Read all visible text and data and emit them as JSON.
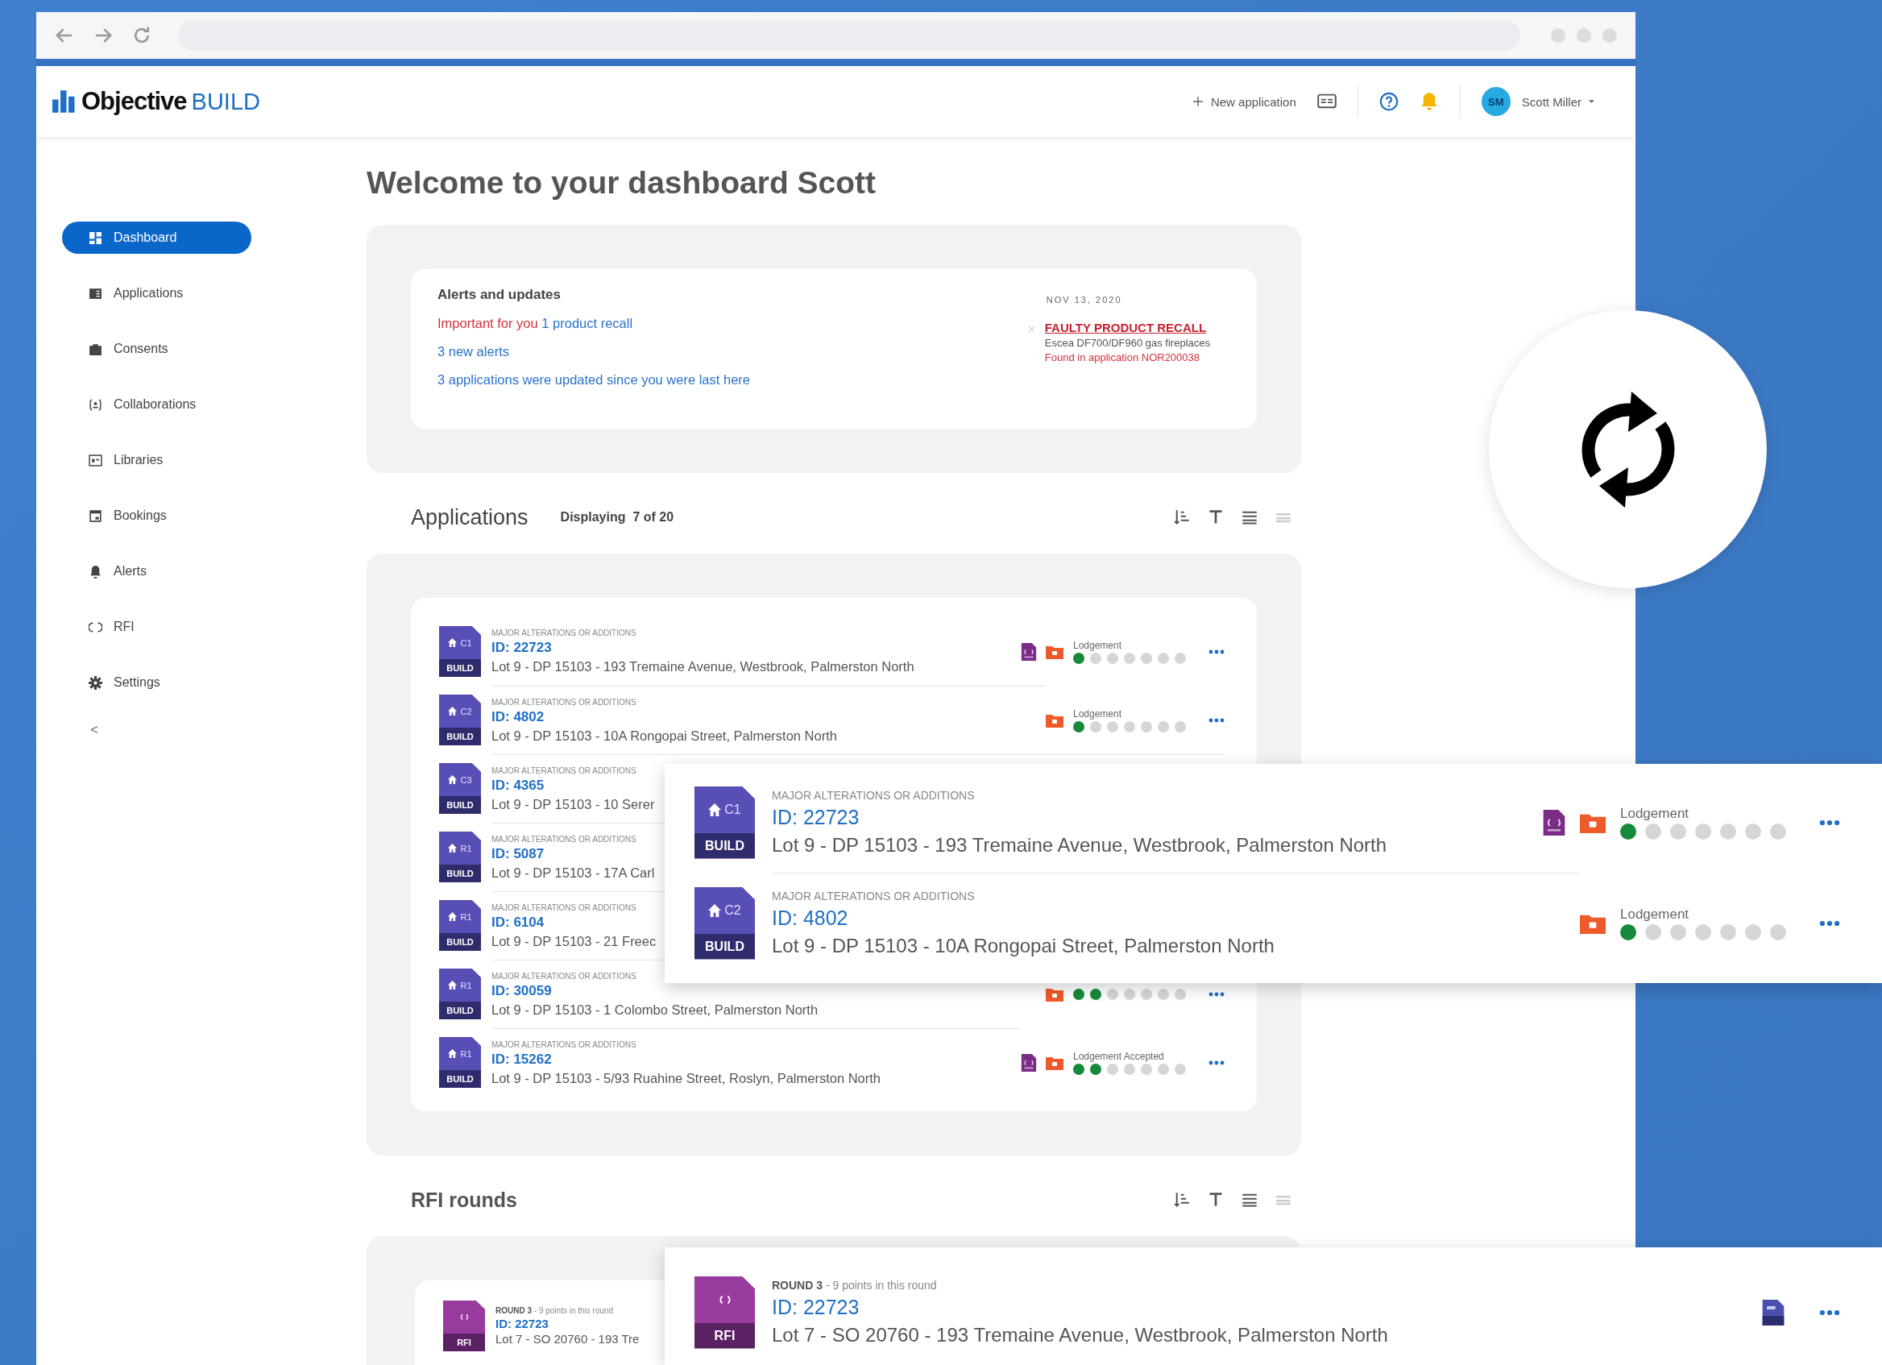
{
  "header": {
    "logo_name": "Objective",
    "logo_product": "BUILD",
    "new_application": "New application",
    "user": {
      "initials": "SM",
      "name": "Scott Miller"
    }
  },
  "sidebar": {
    "items": [
      {
        "label": "Dashboard",
        "kind": "dashboard",
        "selected": true
      },
      {
        "label": "Applications",
        "kind": "applications",
        "selected": false
      },
      {
        "label": "Consents",
        "kind": "consents",
        "selected": false
      },
      {
        "label": "Collaborations",
        "kind": "collaborations",
        "selected": false
      },
      {
        "label": "Libraries",
        "kind": "libraries",
        "selected": false
      },
      {
        "label": "Bookings",
        "kind": "bookings",
        "selected": false
      },
      {
        "label": "Alerts",
        "kind": "alerts",
        "selected": false
      },
      {
        "label": "RFI",
        "kind": "rfi",
        "selected": false
      },
      {
        "label": "Settings",
        "kind": "settings",
        "selected": false
      }
    ],
    "collapse": "<"
  },
  "page_title": "Welcome to your dashboard Scott",
  "alerts": {
    "title": "Alerts and updates",
    "lines": [
      {
        "kind": "important",
        "prefix": "Important for you",
        "text": "1 product recall"
      },
      {
        "kind": "link",
        "text": "3 new alerts"
      },
      {
        "kind": "link",
        "text": "3 applications were updated since you were last here"
      }
    ],
    "recall": {
      "date": "NOV 13, 2020",
      "title": "FAULTY PRODUCT RECALL",
      "product": "Escea DF700/DF960 gas fireplaces",
      "found": "Found in application NOR200038"
    }
  },
  "applications": {
    "title": "Applications",
    "displaying": "Displaying  7 of 20",
    "rows": [
      {
        "category": "MAJOR ALTERATIONS OR ADDITIONS",
        "badge": {
          "code": "C1",
          "label": "BUILD"
        },
        "id": "ID: 22723",
        "address": "Lot 9 - DP 15103 - 193 Tremaine Avenue, Westbrook, Palmerston North",
        "icons": [
          {
            "kind": "rfi"
          },
          {
            "kind": "folder"
          }
        ],
        "status": "Lodgement",
        "steps": [
          {
            "done": true
          },
          {
            "done": false
          },
          {
            "done": false
          },
          {
            "done": false
          },
          {
            "done": false
          },
          {
            "done": false
          },
          {
            "done": false
          }
        ]
      },
      {
        "category": "MAJOR ALTERATIONS OR ADDITIONS",
        "badge": {
          "code": "C2",
          "label": "BUILD"
        },
        "id": "ID: 4802",
        "address": "Lot 9 - DP 15103 - 10A Rongopai Street, Palmerston North",
        "icons": [
          {
            "kind": "folder"
          }
        ],
        "status": "Lodgement",
        "steps": [
          {
            "done": true
          },
          {
            "done": false
          },
          {
            "done": false
          },
          {
            "done": false
          },
          {
            "done": false
          },
          {
            "done": false
          },
          {
            "done": false
          }
        ]
      },
      {
        "category": "MAJOR ALTERATIONS OR ADDITIONS",
        "badge": {
          "code": "C3",
          "label": "BUILD"
        },
        "id": "ID: 4365",
        "address": "Lot 9 - DP 15103 - 10 Serer"
      },
      {
        "category": "MAJOR ALTERATIONS OR ADDITIONS",
        "badge": {
          "code": "R1",
          "label": "BUILD"
        },
        "id": "ID: 5087",
        "address": "Lot 9 - DP 15103 - 17A Carl"
      },
      {
        "category": "MAJOR ALTERATIONS OR ADDITIONS",
        "badge": {
          "code": "R1",
          "label": "BUILD"
        },
        "id": "ID: 6104",
        "address": "Lot 9 - DP 15103 - 21 Freec"
      },
      {
        "category": "MAJOR ALTERATIONS OR ADDITIONS",
        "badge": {
          "code": "R1",
          "label": "BUILD"
        },
        "id": "ID: 30059",
        "address": "Lot 9 - DP 15103 - 1 Colombo Street, Palmerston North",
        "icons": [
          {
            "kind": "folder"
          }
        ],
        "steps": [
          {
            "done": true
          },
          {
            "done": true
          },
          {
            "done": false
          },
          {
            "done": false
          },
          {
            "done": false
          },
          {
            "done": false
          },
          {
            "done": false
          }
        ]
      },
      {
        "category": "MAJOR ALTERATIONS OR ADDITIONS",
        "badge": {
          "code": "R1",
          "label": "BUILD"
        },
        "id": "ID: 15262",
        "address": "Lot 9 - DP 15103 - 5/93 Ruahine Street, Roslyn, Palmerston North",
        "icons": [
          {
            "kind": "rfi"
          },
          {
            "kind": "folder"
          }
        ],
        "status": "Lodgement Accepted",
        "steps": [
          {
            "done": true
          },
          {
            "done": true
          },
          {
            "done": false
          },
          {
            "done": false
          },
          {
            "done": false
          },
          {
            "done": false
          },
          {
            "done": false
          }
        ]
      }
    ]
  },
  "rfi_rounds": {
    "title": "RFI rounds",
    "rows": [
      {
        "round": "**ROUND 3** - 9 points in this round",
        "badge": {
          "label": "RFI"
        },
        "id": "ID: 22723",
        "address": "Lot 7 - SO 20760 - 193 Tre"
      }
    ]
  },
  "zoomed_applications": {
    "rows": [
      {
        "category": "MAJOR ALTERATIONS OR ADDITIONS",
        "badge": {
          "code": "C1",
          "label": "BUILD"
        },
        "id": "ID: 22723",
        "address": "Lot 9 - DP 15103 - 193 Tremaine Avenue, Westbrook, Palmerston North",
        "icons": [
          {
            "kind": "rfi"
          },
          {
            "kind": "folder"
          }
        ],
        "status": "Lodgement",
        "steps": [
          {
            "done": true
          },
          {
            "done": false
          },
          {
            "done": false
          },
          {
            "done": false
          },
          {
            "done": false
          },
          {
            "done": false
          },
          {
            "done": false
          }
        ]
      },
      {
        "category": "MAJOR ALTERATIONS OR ADDITIONS",
        "badge": {
          "code": "C2",
          "label": "BUILD"
        },
        "id": "ID: 4802",
        "address": "Lot 9 - DP 15103 - 10A Rongopai Street, Palmerston North",
        "icons": [
          {
            "kind": "folder"
          }
        ],
        "status": "Lodgement",
        "steps": [
          {
            "done": true
          },
          {
            "done": false
          },
          {
            "done": false
          },
          {
            "done": false
          },
          {
            "done": false
          },
          {
            "done": false
          },
          {
            "done": false
          }
        ]
      }
    ]
  },
  "zoomed_rfi": {
    "rows": [
      {
        "round": "**ROUND 3** - 9 points in this round",
        "badge": {
          "label": "RFI"
        },
        "id": "ID: 22723",
        "address": "Lot 7 - SO 20760 - 193 Tremaine Avenue, Westbrook, Palmerston North",
        "icons": [
          {
            "kind": "build"
          }
        ]
      }
    ]
  }
}
